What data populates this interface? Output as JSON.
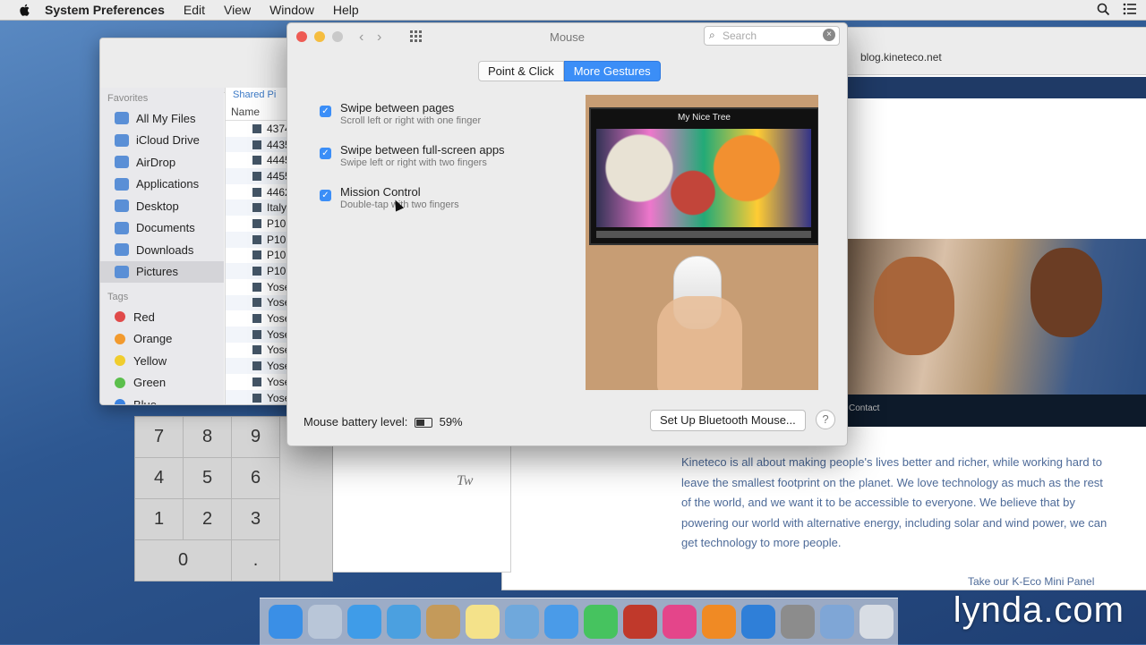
{
  "menubar": {
    "app_name": "System Preferences",
    "items": [
      "Edit",
      "View",
      "Window",
      "Help"
    ]
  },
  "finder": {
    "favorites_title": "Favorites",
    "favorites": [
      "All My Files",
      "iCloud Drive",
      "AirDrop",
      "Applications",
      "Desktop",
      "Documents",
      "Downloads",
      "Pictures"
    ],
    "selected": "Pictures",
    "tags_title": "Tags",
    "tags": [
      {
        "name": "Red",
        "color": "#e04a4a"
      },
      {
        "name": "Orange",
        "color": "#f29a2e"
      },
      {
        "name": "Yellow",
        "color": "#f0cd2e"
      },
      {
        "name": "Green",
        "color": "#5bbf4c"
      },
      {
        "name": "Blue",
        "color": "#3a82e0"
      }
    ],
    "path_label": "Shared Pi",
    "column_header": "Name",
    "files": [
      "4374",
      "4435",
      "4445",
      "4455",
      "4462",
      "Italy",
      "P10",
      "P10",
      "P10",
      "P10",
      "Yose",
      "Yose",
      "Yose",
      "Yose",
      "Yose",
      "Yose",
      "Yose",
      "Yose"
    ]
  },
  "calculator": {
    "rows": [
      [
        "7",
        "8",
        "9"
      ],
      [
        "4",
        "5",
        "6"
      ],
      [
        "1",
        "2",
        "3"
      ],
      [
        "0",
        "",
        "."
      ]
    ],
    "ops": [
      "-",
      "-",
      "+",
      "="
    ]
  },
  "document": {
    "text": "Tw"
  },
  "browser": {
    "url": "blog.kineteco.net",
    "paragraph": "Kineteco is all about making people's lives better and richer, while working hard to leave the smallest footprint on the planet. We love technology as much as the rest of the world, and we want it to be accessible to everyone. We believe that by powering our world with alternative energy, including solar and wind power, we can get technology to more people.",
    "cta": "Take our K-Eco Mini Panel",
    "caption": "Contact"
  },
  "prefs": {
    "window_title": "Mouse",
    "search_placeholder": "Search",
    "tabs": [
      "Point & Click",
      "More Gestures"
    ],
    "active_tab": "More Gestures",
    "options": [
      {
        "label": "Swipe between pages",
        "sub": "Scroll left or right with one finger",
        "checked": true
      },
      {
        "label": "Swipe between full-screen apps",
        "sub": "Swipe left or right with two fingers",
        "checked": true
      },
      {
        "label": "Mission Control",
        "sub": "Double-tap with two fingers",
        "checked": true
      }
    ],
    "preview_page_title": "My Nice Tree",
    "battery_label": "Mouse battery level:",
    "battery_percent": "59%",
    "bluetooth_button": "Set Up Bluetooth Mouse...",
    "help_icon": "question-icon"
  },
  "dock": {
    "icons": [
      {
        "name": "finder",
        "color": "#3a8fe6"
      },
      {
        "name": "launchpad",
        "color": "#b9c6d8"
      },
      {
        "name": "safari",
        "color": "#3f9ce8"
      },
      {
        "name": "mail",
        "color": "#4ba0e0"
      },
      {
        "name": "contacts",
        "color": "#c49a5a"
      },
      {
        "name": "notes",
        "color": "#f4e28a"
      },
      {
        "name": "preview",
        "color": "#6fa8dc"
      },
      {
        "name": "messages",
        "color": "#4a9be8"
      },
      {
        "name": "facetime",
        "color": "#46c35f"
      },
      {
        "name": "photo-booth",
        "color": "#c0392b"
      },
      {
        "name": "itunes",
        "color": "#e4458a"
      },
      {
        "name": "ibooks",
        "color": "#f08a24"
      },
      {
        "name": "app-store",
        "color": "#2f7fd8"
      },
      {
        "name": "system-preferences",
        "color": "#8c8c8c"
      },
      {
        "name": "downloads-stack",
        "color": "#7fa6d6"
      },
      {
        "name": "trash",
        "color": "#d8dde4"
      }
    ]
  },
  "watermark": "lynda.com"
}
